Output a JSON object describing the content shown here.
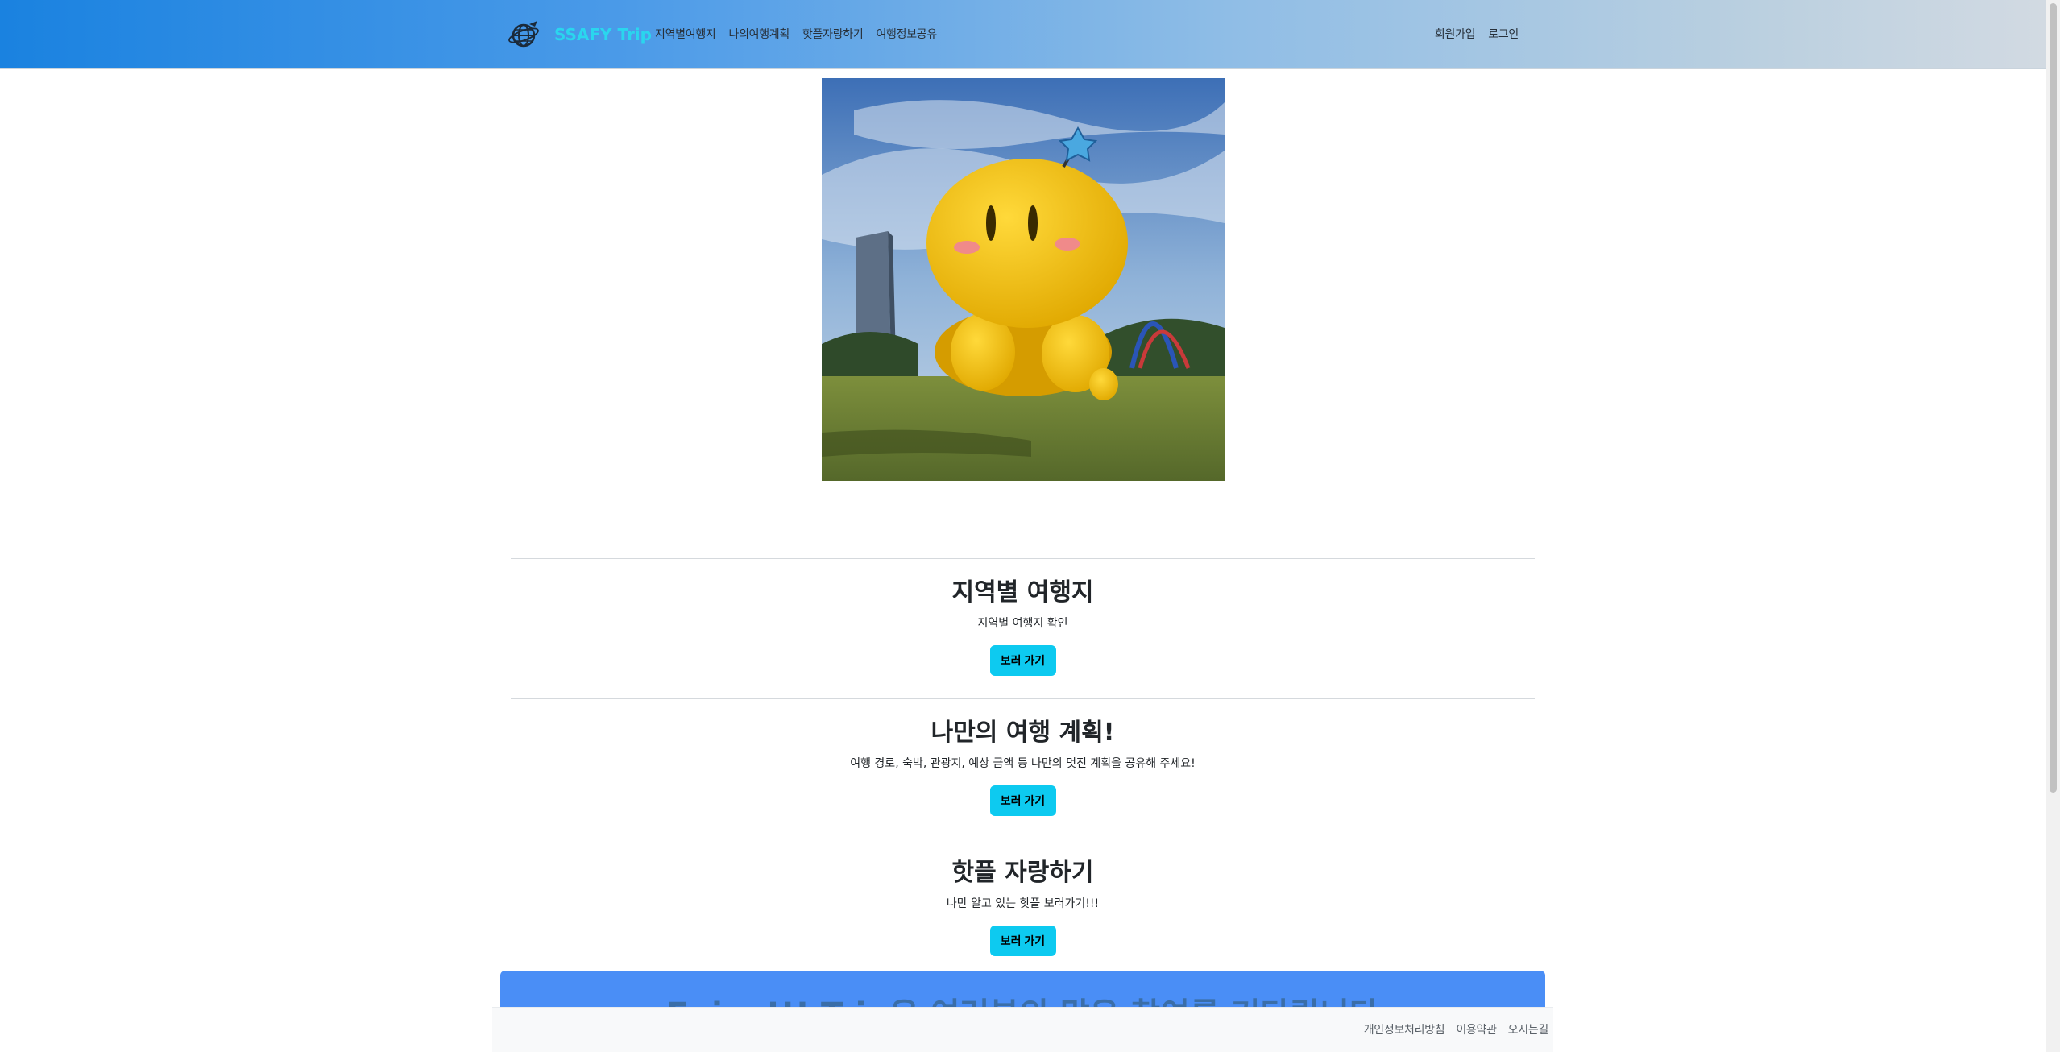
{
  "navbar": {
    "brand": "SSAFY Trip",
    "logo_icon": "globe-airplane-icon",
    "left_links": [
      "지역별여행지",
      "나의여행계획",
      "핫플자랑하기",
      "여행정보공유"
    ],
    "right_links": [
      "회원가입",
      "로그인"
    ]
  },
  "hero": {
    "image_icon": "yellow-balloon-mascot-photo"
  },
  "sections": [
    {
      "title": "지역별 여행지",
      "description": "지역별 여행지 확인",
      "button": "보러 가기"
    },
    {
      "title": "나만의 여행 계획!",
      "description": "여행 경로, 숙박, 관광지, 예상 금액 등 나만의 멋진 계획을 공유해 주세요!",
      "button": "보러 가기"
    },
    {
      "title": "핫플 자랑하기",
      "description": "나만 알고 있는 핫플 보러가기!!!",
      "button": "보러 가기"
    }
  ],
  "banner": {
    "text": "Enjoy!!! Trip은 여러분의 많은 참여를 기다립니다"
  },
  "footer": {
    "links": [
      "개인정보처리방침",
      "이용약관",
      "오시는길"
    ]
  },
  "colors": {
    "nav_gradient_start": "#1a82e0",
    "nav_gradient_end": "#d2dae2",
    "brand": "#2ad6ee",
    "button": "#0dcaf0",
    "banner": "#4a8ef6"
  }
}
